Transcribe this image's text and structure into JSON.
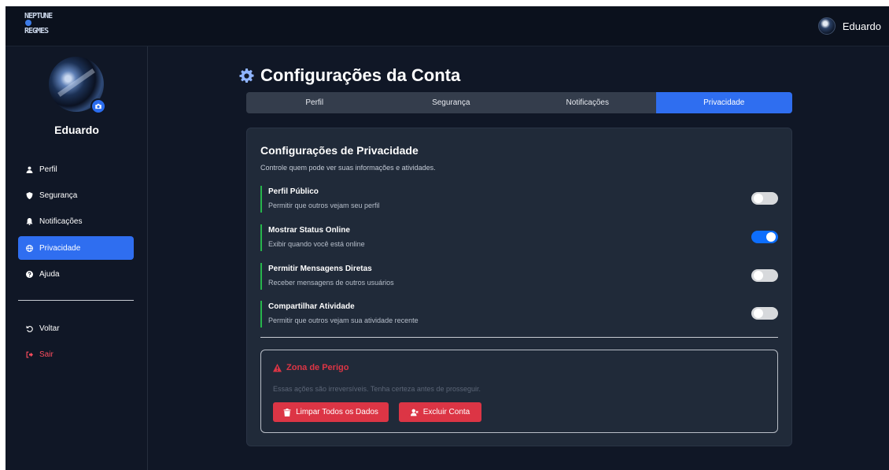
{
  "topbar": {
    "logo_line1": "NEPTUNE",
    "logo_line2": "REGMES",
    "user_name": "Eduardo"
  },
  "sidebar": {
    "user_name": "Eduardo",
    "items": [
      {
        "label": "Perfil",
        "icon": "user-icon"
      },
      {
        "label": "Segurança",
        "icon": "shield-icon"
      },
      {
        "label": "Notificações",
        "icon": "bell-icon"
      },
      {
        "label": "Privacidade",
        "icon": "globe-icon",
        "active": true
      },
      {
        "label": "Ajuda",
        "icon": "question-circle-icon"
      }
    ],
    "back_label": "Voltar",
    "logout_label": "Sair"
  },
  "main": {
    "page_title": "Configurações da Conta",
    "tabs": [
      {
        "label": "Perfil"
      },
      {
        "label": "Segurança"
      },
      {
        "label": "Notificações"
      },
      {
        "label": "Privacidade",
        "active": true
      }
    ],
    "panel": {
      "title": "Configurações de Privacidade",
      "subtitle": "Controle quem pode ver suas informações e atividades.",
      "settings": [
        {
          "title": "Perfil Público",
          "description": "Permitir que outros vejam seu perfil",
          "enabled": false
        },
        {
          "title": "Mostrar Status Online",
          "description": "Exibir quando você está online",
          "enabled": true
        },
        {
          "title": "Permitir Mensagens Diretas",
          "description": "Receber mensagens de outros usuários",
          "enabled": false
        },
        {
          "title": "Compartilhar Atividade",
          "description": "Permitir que outros vejam sua atividade recente",
          "enabled": false
        }
      ],
      "danger_zone": {
        "title": "Zona de Perigo",
        "description": "Essas ações são irreversíveis. Tenha certeza antes de prosseguir.",
        "clear_button": "Limpar Todos os Dados",
        "delete_button": "Excluir Conta"
      }
    }
  },
  "colors": {
    "background": "#101726",
    "panel": "#202a39",
    "accent": "#2f6ef0",
    "success_border": "#27b54c",
    "danger": "#dc3545"
  }
}
